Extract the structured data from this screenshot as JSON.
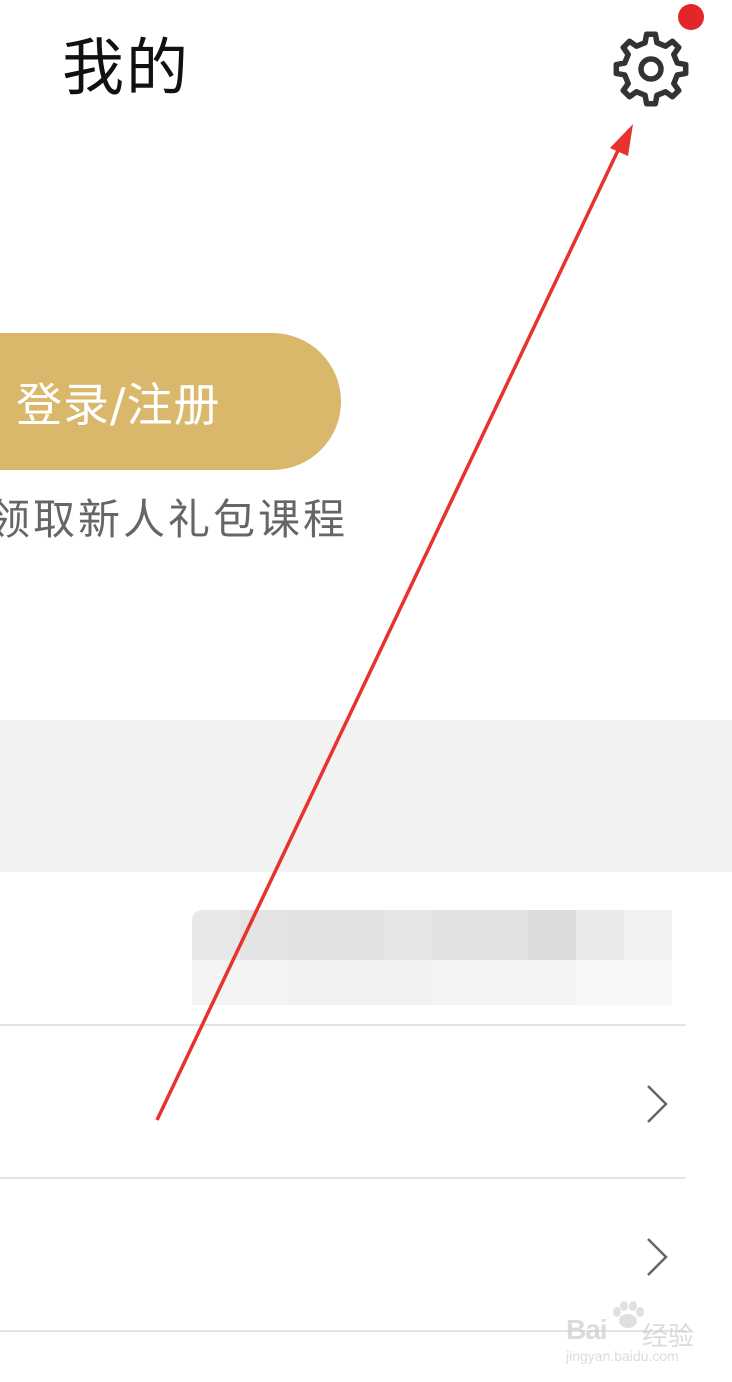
{
  "header": {
    "title": "我的",
    "settings_icon": "gear-icon",
    "notification_dot_color": "#e3262a"
  },
  "login": {
    "button_label": "登录/注册",
    "button_color": "#d9b86c",
    "promo_text": "领取新人礼包课程",
    "promo_color": "#666666"
  },
  "section_band_color": "#f2f2f2",
  "list": {
    "rows": [
      {
        "label": "",
        "chevron_icon": "chevron-right-icon"
      },
      {
        "label": "",
        "chevron_icon": "chevron-right-icon"
      }
    ]
  },
  "annotation": {
    "arrow_color": "#e8322d"
  },
  "watermark": {
    "logo": "Bai",
    "name": "经验",
    "url": "jingyan.baidu.com"
  }
}
